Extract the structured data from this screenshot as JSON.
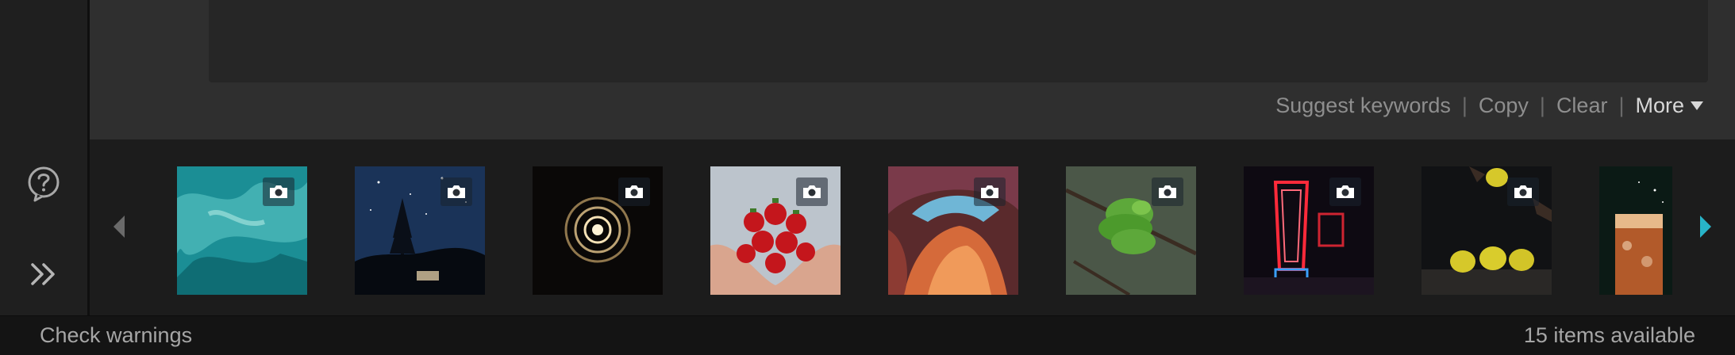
{
  "keyword_actions": {
    "suggest_label": "Suggest keywords",
    "copy_label": "Copy",
    "clear_label": "Clear",
    "more_label": "More",
    "separator": "|"
  },
  "left_rail": {
    "help_icon": "question-circle-icon",
    "expand_icon": "double-chevron-right-icon"
  },
  "filmstrip": {
    "prev_icon": "triangle-left-icon",
    "next_icon": "triangle-right-icon",
    "accent_color": "#28b4c8",
    "media_type_icon": "camera-icon",
    "thumbnails": [
      {
        "subject": "turquoise-water"
      },
      {
        "subject": "starry-night-forest"
      },
      {
        "subject": "light-spiral"
      },
      {
        "subject": "strawberries-in-hands"
      },
      {
        "subject": "antelope-canyon"
      },
      {
        "subject": "green-snake"
      },
      {
        "subject": "neon-sign"
      },
      {
        "subject": "lemons-on-table"
      },
      {
        "subject": "iced-drink"
      }
    ]
  },
  "status_bar": {
    "warnings_label": "Check warnings",
    "items_available": "15 items available"
  }
}
